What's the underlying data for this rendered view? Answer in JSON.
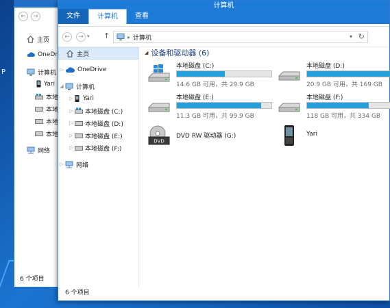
{
  "window": {
    "title": "计算机",
    "tabs": [
      "文件",
      "计算机",
      "查看"
    ],
    "status": "6 个项目"
  },
  "address": {
    "crumb": "计算机"
  },
  "nav": {
    "items": [
      {
        "label": "主页",
        "icon": "home-icon"
      },
      {
        "label": "OneDrive",
        "icon": "cloud-icon"
      },
      {
        "label": "计算机",
        "icon": "computer-icon"
      },
      {
        "label": "Yari",
        "icon": "phone-icon"
      },
      {
        "label": "本地磁盘 (C:)",
        "icon": "windows-drive-icon"
      },
      {
        "label": "本地磁盘 (D:)",
        "icon": "drive-icon"
      },
      {
        "label": "本地磁盘 (E:)",
        "icon": "drive-icon"
      },
      {
        "label": "本地磁盘 (F:)",
        "icon": "drive-icon"
      },
      {
        "label": "网络",
        "icon": "network-icon"
      }
    ]
  },
  "content": {
    "group_title": "设备和驱动器 (6)",
    "drives": [
      {
        "name": "本地磁盘 (C:)",
        "info": "14.6 GB 可用，共 29.9 GB",
        "used_fraction": 0.51
      },
      {
        "name": "本地磁盘 (D:)",
        "info": "20.9 GB 可用，共 169 GB",
        "used_fraction": 0.88
      },
      {
        "name": "本地磁盘 (E:)",
        "info": "11.3 GB 可用，共 99.9 GB",
        "used_fraction": 0.89
      },
      {
        "name": "本地磁盘 (F:)",
        "info": "118 GB 可用，共 334 GB",
        "used_fraction": 0.65
      }
    ],
    "dvd": {
      "name": "DVD RW 驱动器 (G:)"
    },
    "phone": {
      "name": "Yari"
    }
  },
  "back_window": {
    "items": [
      "主页",
      "OneDr",
      "计算机",
      "Yari",
      "本地",
      "本地",
      "本地",
      "本地",
      "网络"
    ],
    "status": "6 个项目",
    "tabs_partial": "文件"
  },
  "colors": {
    "accent": "#1e7ad7",
    "bar_fill": "#26a0da",
    "selection": "#dcebfb"
  }
}
